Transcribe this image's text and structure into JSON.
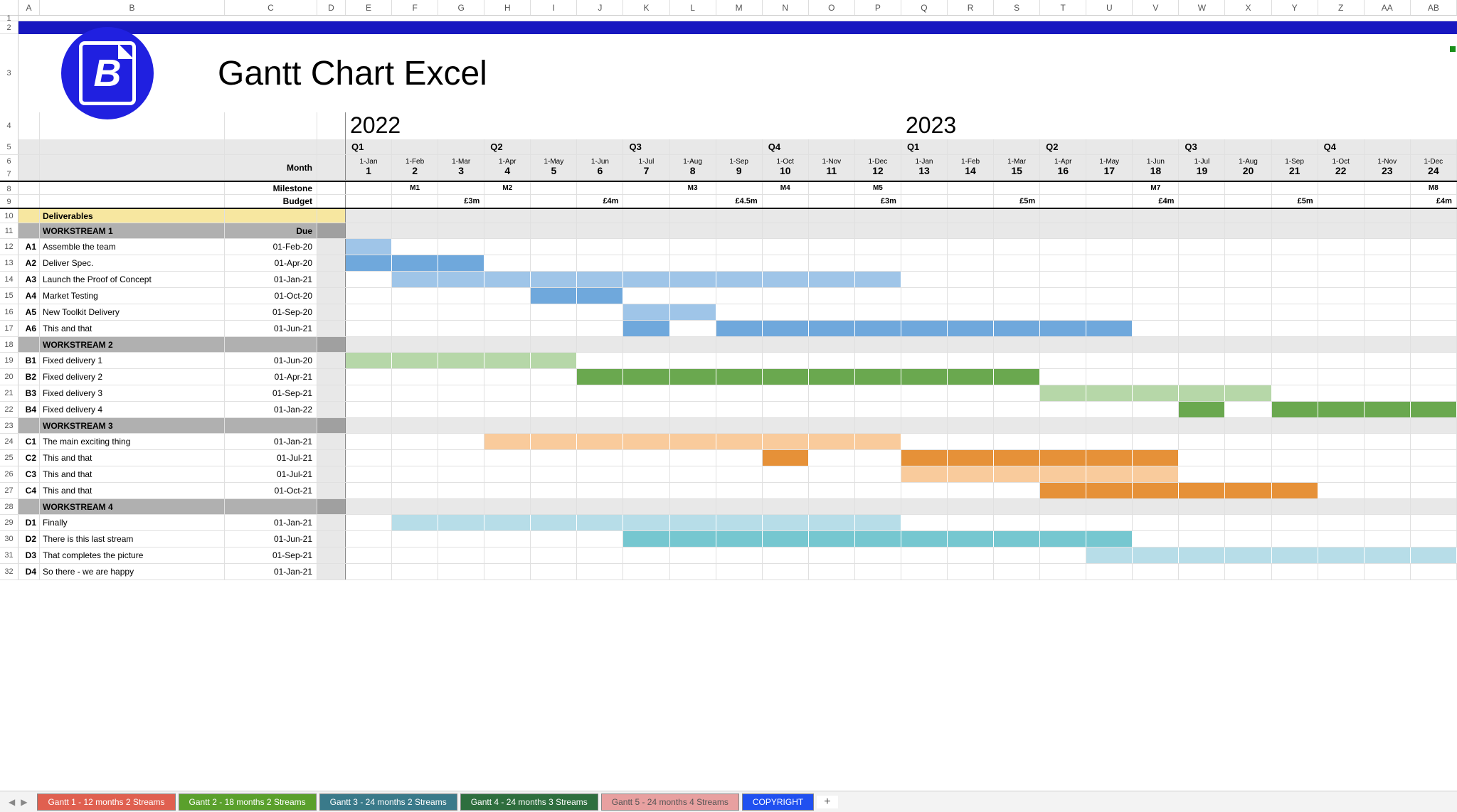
{
  "columns": [
    "A",
    "B",
    "C",
    "D",
    "E",
    "F",
    "G",
    "H",
    "I",
    "J",
    "K",
    "L",
    "M",
    "N",
    "O",
    "P",
    "Q",
    "R",
    "S",
    "T",
    "U",
    "V",
    "W",
    "X",
    "Y",
    "Z",
    "AA",
    "AB"
  ],
  "row_numbers": [
    1,
    2,
    3,
    4,
    5,
    6,
    7,
    8,
    9,
    10,
    11,
    12,
    13,
    14,
    15,
    16,
    17,
    18,
    19,
    20,
    21,
    22,
    23,
    24,
    25,
    26,
    27,
    28,
    29,
    30,
    31
  ],
  "title": "Gantt Chart Excel",
  "logo_letter": "B",
  "years": {
    "left": "2022",
    "right": "2023"
  },
  "quarters": [
    "Q1",
    "",
    "",
    "Q2",
    "",
    "",
    "Q3",
    "",
    "",
    "Q4",
    "",
    "",
    "Q1",
    "",
    "",
    "Q2",
    "",
    "",
    "Q3",
    "",
    "",
    "Q4",
    "",
    ""
  ],
  "month_dates": [
    "1-Jan",
    "1-Feb",
    "1-Mar",
    "1-Apr",
    "1-May",
    "1-Jun",
    "1-Jul",
    "1-Aug",
    "1-Sep",
    "1-Oct",
    "1-Nov",
    "1-Dec",
    "1-Jan",
    "1-Feb",
    "1-Mar",
    "1-Apr",
    "1-May",
    "1-Jun",
    "1-Jul",
    "1-Aug",
    "1-Sep",
    "1-Oct",
    "1-Nov",
    "1-Dec"
  ],
  "month_nums": [
    "1",
    "2",
    "3",
    "4",
    "5",
    "6",
    "7",
    "8",
    "9",
    "10",
    "11",
    "12",
    "13",
    "14",
    "15",
    "16",
    "17",
    "18",
    "19",
    "20",
    "21",
    "22",
    "23",
    "24"
  ],
  "label_month": "Month",
  "label_milestone": "Milestone",
  "label_budget": "Budget",
  "milestones": [
    "",
    "M1",
    "",
    "M2",
    "",
    "",
    "",
    "M3",
    "",
    "M4",
    "",
    "M5",
    "",
    "",
    "",
    "",
    "",
    "M7",
    "",
    "",
    "",
    "",
    "",
    "M8"
  ],
  "budgets": [
    "",
    "",
    "£3m",
    "",
    "",
    "£4m",
    "",
    "",
    "£4.5m",
    "",
    "",
    "£3m",
    "",
    "",
    "£5m",
    "",
    "",
    "£4m",
    "",
    "",
    "£5m",
    "",
    "",
    "£4m"
  ],
  "deliverables_label": "Deliverables",
  "due_label": "Due",
  "workstreams": [
    {
      "header": "WORKSTREAM 1",
      "tasks": [
        {
          "id": "A1",
          "name": "Assemble the team",
          "due": "01-Feb-20",
          "style": "ws1-light",
          "bars": [
            0
          ]
        },
        {
          "id": "A2",
          "name": "Deliver Spec.",
          "due": "01-Apr-20",
          "style": "ws1-dark",
          "bars": [
            0,
            1,
            2
          ]
        },
        {
          "id": "A3",
          "name": "Launch the Proof of Concept",
          "due": "01-Jan-21",
          "style": "ws1-light",
          "bars": [
            1,
            2,
            3,
            4,
            5,
            6,
            7,
            8,
            9,
            10,
            11
          ]
        },
        {
          "id": "A4",
          "name": "Market Testing",
          "due": "01-Oct-20",
          "style": "ws1-dark",
          "bars": [
            4,
            5
          ]
        },
        {
          "id": "A5",
          "name": "New Toolkit Delivery",
          "due": "01-Sep-20",
          "style": "ws1-light",
          "bars": [
            6,
            7
          ]
        },
        {
          "id": "A6",
          "name": "This and that",
          "due": "01-Jun-21",
          "style": "ws1-dark",
          "bars": [
            6,
            8,
            9,
            10,
            11,
            12,
            13,
            14,
            15,
            16
          ]
        }
      ]
    },
    {
      "header": "WORKSTREAM 2",
      "tasks": [
        {
          "id": "B1",
          "name": "Fixed delivery 1",
          "due": "01-Jun-20",
          "style": "ws2-light",
          "bars": [
            0,
            1,
            2,
            3,
            4
          ]
        },
        {
          "id": "B2",
          "name": "Fixed delivery 2",
          "due": "01-Apr-21",
          "style": "ws2-dark",
          "bars": [
            5,
            6,
            7,
            8,
            9,
            10,
            11,
            12,
            13,
            14
          ]
        },
        {
          "id": "B3",
          "name": "Fixed delivery 3",
          "due": "01-Sep-21",
          "style": "ws2-light",
          "bars": [
            15,
            16,
            17,
            18,
            19
          ]
        },
        {
          "id": "B4",
          "name": "Fixed delivery 4",
          "due": "01-Jan-22",
          "style": "ws2-dark",
          "bars": [
            18,
            20,
            21,
            22,
            23
          ]
        }
      ]
    },
    {
      "header": "WORKSTREAM 3",
      "tasks": [
        {
          "id": "C1",
          "name": "The main exciting thing",
          "due": "01-Jan-21",
          "style": "ws3-light",
          "bars": [
            3,
            4,
            5,
            6,
            7,
            8,
            9,
            10,
            11
          ]
        },
        {
          "id": "C2",
          "name": "This and that",
          "due": "01-Jul-21",
          "style": "ws3-dark",
          "bars": [
            9,
            12,
            13,
            14,
            15,
            16,
            17
          ]
        },
        {
          "id": "C3",
          "name": "This and that",
          "due": "01-Jul-21",
          "style": "ws3-light",
          "bars": [
            12,
            13,
            14,
            15,
            16,
            17
          ]
        },
        {
          "id": "C4",
          "name": "This and that",
          "due": "01-Oct-21",
          "style": "ws3-dark",
          "bars": [
            15,
            16,
            17,
            18,
            19,
            20
          ]
        }
      ]
    },
    {
      "header": "WORKSTREAM 4",
      "tasks": [
        {
          "id": "D1",
          "name": "Finally",
          "due": "01-Jan-21",
          "style": "ws4-light",
          "bars": [
            1,
            2,
            3,
            4,
            5,
            6,
            7,
            8,
            9,
            10,
            11
          ]
        },
        {
          "id": "D2",
          "name": "There is this last stream",
          "due": "01-Jun-21",
          "style": "ws4-dark",
          "bars": [
            6,
            7,
            8,
            9,
            10,
            11,
            12,
            13,
            14,
            15,
            16
          ]
        },
        {
          "id": "D3",
          "name": "That completes the picture",
          "due": "01-Sep-21",
          "style": "ws4-light",
          "bars": [
            16,
            17,
            18,
            19,
            20,
            21,
            22,
            23
          ]
        },
        {
          "id": "D4",
          "name": "So there - we are happy",
          "due": "01-Jan-21",
          "style": "ws4-light",
          "bars": []
        }
      ]
    }
  ],
  "tabs": [
    {
      "label": "Gantt 1 - 12 months  2 Streams",
      "cls": "red"
    },
    {
      "label": "Gantt 2 - 18 months 2 Streams",
      "cls": "green"
    },
    {
      "label": "Gantt 3 - 24 months 2 Streams",
      "cls": "teal"
    },
    {
      "label": "Gantt 4 - 24 months 3 Streams",
      "cls": "dgreen"
    },
    {
      "label": "Gantt 5 - 24 months 4 Streams",
      "cls": "pink"
    },
    {
      "label": "COPYRIGHT",
      "cls": "blue"
    }
  ],
  "chart_data": {
    "type": "bar",
    "title": "Gantt Chart Excel",
    "x": [
      "Jan 2022",
      "Feb 2022",
      "Mar 2022",
      "Apr 2022",
      "May 2022",
      "Jun 2022",
      "Jul 2022",
      "Aug 2022",
      "Sep 2022",
      "Oct 2022",
      "Nov 2022",
      "Dec 2022",
      "Jan 2023",
      "Feb 2023",
      "Mar 2023",
      "Apr 2023",
      "May 2023",
      "Jun 2023",
      "Jul 2023",
      "Aug 2023",
      "Sep 2023",
      "Oct 2023",
      "Nov 2023",
      "Dec 2023"
    ],
    "series": [
      {
        "name": "A1 Assemble the team",
        "start": 0,
        "end": 0
      },
      {
        "name": "A2 Deliver Spec.",
        "start": 0,
        "end": 2
      },
      {
        "name": "A3 Launch the Proof of Concept",
        "start": 1,
        "end": 11
      },
      {
        "name": "A4 Market Testing",
        "start": 4,
        "end": 5
      },
      {
        "name": "A5 New Toolkit Delivery",
        "start": 6,
        "end": 7
      },
      {
        "name": "A6 This and that",
        "start": 6,
        "end": 16
      },
      {
        "name": "B1 Fixed delivery 1",
        "start": 0,
        "end": 4
      },
      {
        "name": "B2 Fixed delivery 2",
        "start": 5,
        "end": 14
      },
      {
        "name": "B3 Fixed delivery 3",
        "start": 15,
        "end": 19
      },
      {
        "name": "B4 Fixed delivery 4",
        "start": 18,
        "end": 23
      },
      {
        "name": "C1 The main exciting thing",
        "start": 3,
        "end": 11
      },
      {
        "name": "C2 This and that",
        "start": 9,
        "end": 17
      },
      {
        "name": "C3 This and that",
        "start": 12,
        "end": 17
      },
      {
        "name": "C4 This and that",
        "start": 15,
        "end": 20
      },
      {
        "name": "D1 Finally",
        "start": 1,
        "end": 11
      },
      {
        "name": "D2 There is this last stream",
        "start": 6,
        "end": 16
      },
      {
        "name": "D3 That completes the picture",
        "start": 16,
        "end": 23
      }
    ],
    "milestones": {
      "M1": "Feb 2022",
      "M2": "Apr 2022",
      "M3": "Aug 2022",
      "M4": "Oct 2022",
      "M5": "Dec 2022",
      "M7": "Jun 2023",
      "M8": "Dec 2023"
    },
    "budget_per_quarter": {
      "Q1 2022": "£3m",
      "Q2 2022": "£4m",
      "Q3 2022": "£4.5m",
      "Q4 2022": "£3m",
      "Q1 2023": "£5m",
      "Q2 2023": "£4m",
      "Q3 2023": "£5m",
      "Q4 2023": "£4m"
    }
  }
}
